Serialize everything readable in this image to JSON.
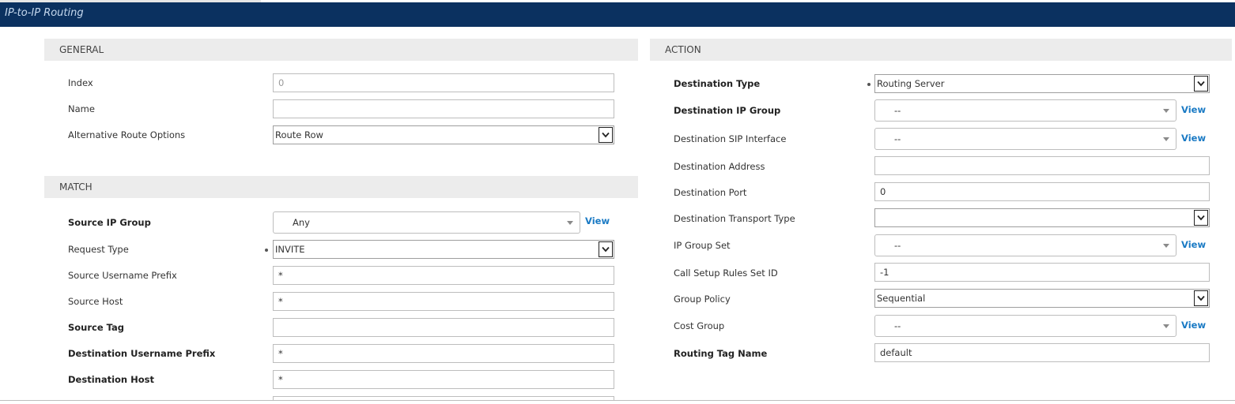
{
  "window": {
    "title": "IP-to-IP Routing"
  },
  "general": {
    "header": "GENERAL",
    "index": {
      "label": "Index",
      "value": "0"
    },
    "name": {
      "label": "Name",
      "value": ""
    },
    "alt_route": {
      "label": "Alternative Route Options",
      "value": "Route Row"
    }
  },
  "match": {
    "header": "MATCH",
    "source_ip_group": {
      "label": "Source IP Group",
      "value": "Any",
      "link": "View"
    },
    "request_type": {
      "label": "Request Type",
      "value": "INVITE"
    },
    "source_username_prefix": {
      "label": "Source Username Prefix",
      "value": "*"
    },
    "source_host": {
      "label": "Source Host",
      "value": "*"
    },
    "source_tag": {
      "label": "Source Tag",
      "value": ""
    },
    "dest_username_prefix": {
      "label": "Destination Username Prefix",
      "value": "*"
    },
    "dest_host": {
      "label": "Destination Host",
      "value": "*"
    }
  },
  "action": {
    "header": "ACTION",
    "dest_type": {
      "label": "Destination Type",
      "value": "Routing Server"
    },
    "dest_ip_group": {
      "label": "Destination IP Group",
      "value": "--",
      "link": "View"
    },
    "dest_sip_interface": {
      "label": "Destination SIP Interface",
      "value": "--",
      "link": "View"
    },
    "dest_address": {
      "label": "Destination Address",
      "value": ""
    },
    "dest_port": {
      "label": "Destination Port",
      "value": "0"
    },
    "dest_transport": {
      "label": "Destination Transport Type",
      "value": ""
    },
    "ip_group_set": {
      "label": "IP Group Set",
      "value": "--",
      "link": "View"
    },
    "call_setup_rules": {
      "label": "Call Setup Rules Set ID",
      "value": "-1"
    },
    "group_policy": {
      "label": "Group Policy",
      "value": "Sequential"
    },
    "cost_group": {
      "label": "Cost Group",
      "value": "--",
      "link": "View"
    },
    "routing_tag": {
      "label": "Routing Tag Name",
      "value": "default"
    }
  }
}
